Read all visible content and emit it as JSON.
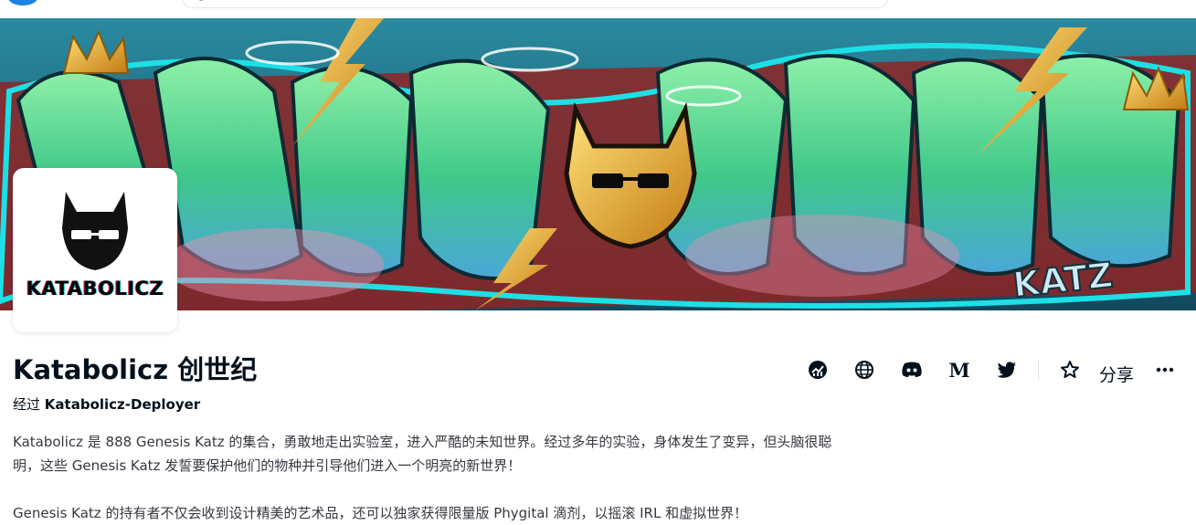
{
  "collection": {
    "name": "Katabolicz 创世纪",
    "by_prefix": "经过",
    "creator": "Katabolicz-Deployer",
    "avatar_wordmark": "KATABOLICZ",
    "description": [
      "Katabolicz 是 888 Genesis Katz 的集合，勇敢地走出实验室，进入严酷的未知世界。经过多年的实验，身体发生了变异，但头脑很聪明，这些 Genesis Katz 发誓要保护他们的物种并引导他们进入一个明亮的新世界！",
      "Genesis Katz 的持有者不仅会收到设计精美的艺术品，还可以独家获得限量版 Phygital 滴剂，以摇滚 IRL 和虚拟世界！"
    ]
  },
  "actions": {
    "icons": [
      "activity-icon",
      "globe-icon",
      "discord-icon",
      "medium-icon",
      "twitter-icon",
      "star-icon",
      "more-icon"
    ],
    "medium_glyph": "M",
    "share_label": "分享"
  },
  "colors": {
    "text": "#04111d",
    "muted": "#353840",
    "banner_teal": "#1d6a86",
    "graffiti_green": "#4fd68e",
    "graffiti_red": "#9e2a2a",
    "gold": "#e0a21a"
  }
}
